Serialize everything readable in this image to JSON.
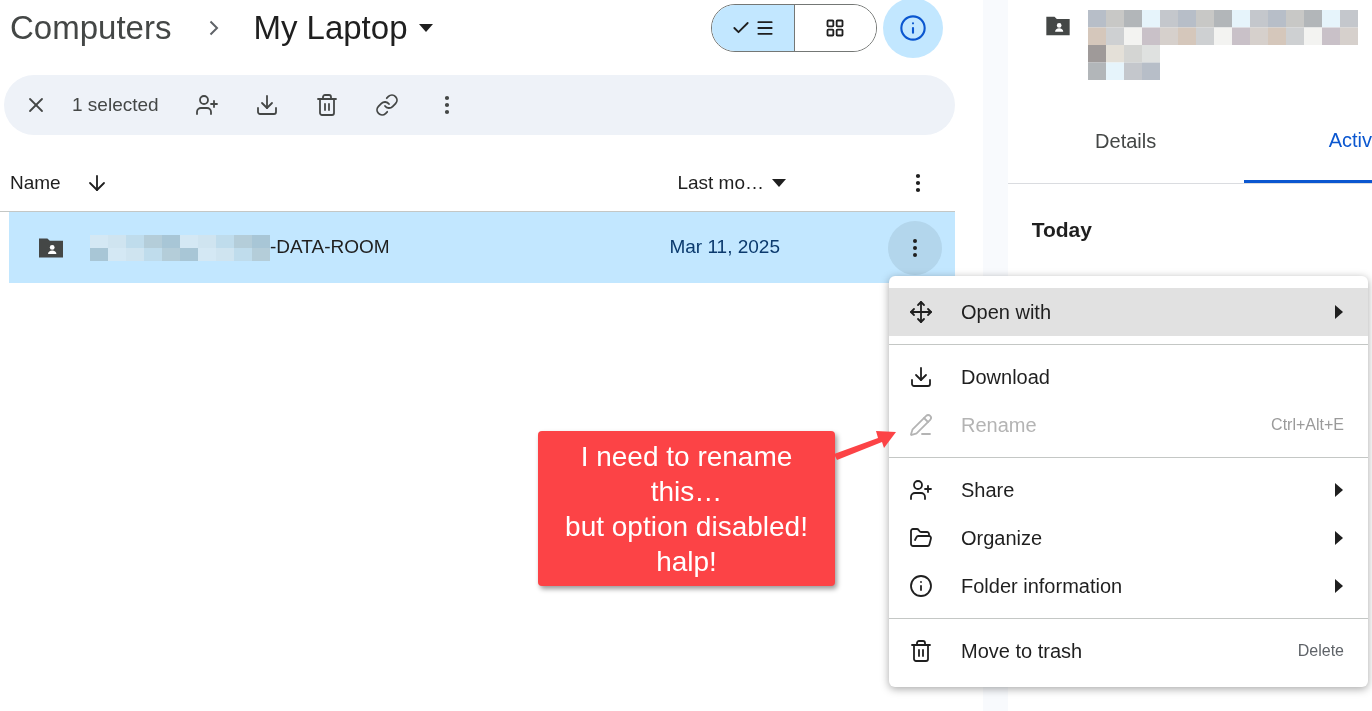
{
  "breadcrumb": {
    "parent": "Computers",
    "current": "My Laptop"
  },
  "view_toggle": [
    {
      "kind": "list",
      "selected": true
    },
    {
      "kind": "grid",
      "selected": false
    }
  ],
  "info_button": {
    "selected": true
  },
  "selection_bar": {
    "count": "1 selected"
  },
  "columns": {
    "name": "Name",
    "modified": "Last mo…"
  },
  "rows": [
    {
      "name": "-DATA-ROOM",
      "modified": "Mar 11, 2025",
      "selected": true
    }
  ],
  "details_panel": {
    "tabs": [
      {
        "label": "Details",
        "selected": false
      },
      {
        "label": "Activ",
        "selected": true
      }
    ],
    "section": "Today"
  },
  "context_menu": {
    "items": [
      {
        "kind": "open",
        "label": "Open with",
        "submenu": true,
        "disabled": false,
        "highlighted": true
      },
      {
        "kind": "divider"
      },
      {
        "kind": "download",
        "label": "Download",
        "submenu": false,
        "disabled": false,
        "highlighted": false
      },
      {
        "kind": "rename",
        "label": "Rename",
        "shortcut": "Ctrl+Alt+E",
        "submenu": false,
        "disabled": true,
        "highlighted": false
      },
      {
        "kind": "divider"
      },
      {
        "kind": "share",
        "label": "Share",
        "submenu": true,
        "disabled": false,
        "highlighted": false
      },
      {
        "kind": "organize",
        "label": "Organize",
        "submenu": true,
        "disabled": false,
        "highlighted": false
      },
      {
        "kind": "information",
        "label": "Folder information",
        "submenu": true,
        "disabled": false,
        "highlighted": false
      },
      {
        "kind": "divider"
      },
      {
        "kind": "trash",
        "label": "Move to trash",
        "shortcut": "Delete",
        "submenu": false,
        "disabled": false,
        "highlighted": false
      }
    ]
  },
  "callout": {
    "text": "I need to rename\nthis…\nbut option disabled!\nhalp!"
  }
}
